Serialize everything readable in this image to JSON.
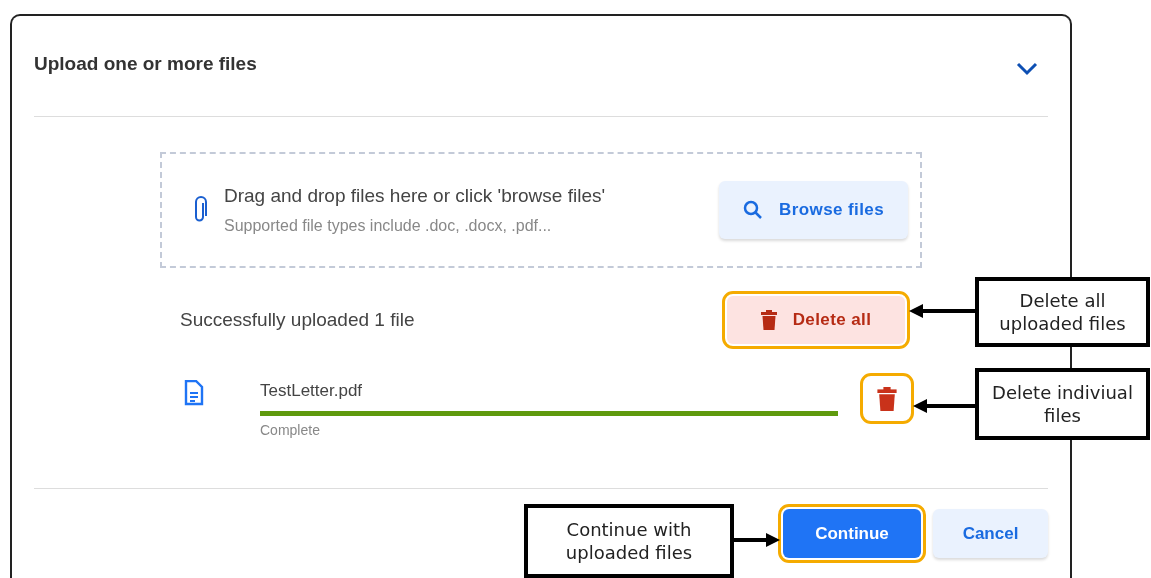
{
  "dialog": {
    "title": "Upload one or more files"
  },
  "dropzone": {
    "heading": "Drag and drop files here or click 'browse files'",
    "hint": "Supported file types include .doc, .docx, .pdf...",
    "browse_button": {
      "label": "Browse files",
      "highlighted": false
    }
  },
  "upload_summary": {
    "text": "Successfully uploaded 1 file",
    "delete_all_button": {
      "label": "Delete all",
      "highlighted": true
    }
  },
  "files": [
    {
      "name": "TestLetter.pdf",
      "level": 1,
      "status": "Complete",
      "delete_highlighted": true
    }
  ],
  "buttons": [
    {
      "label": "Continue",
      "kind": "primary",
      "highlighted": true
    },
    {
      "label": "Cancel",
      "kind": "secondary",
      "highlighted": false
    }
  ],
  "annotations": [
    "Delete all uploaded files",
    "Delete indiviual files",
    "Continue with uploaded files"
  ]
}
